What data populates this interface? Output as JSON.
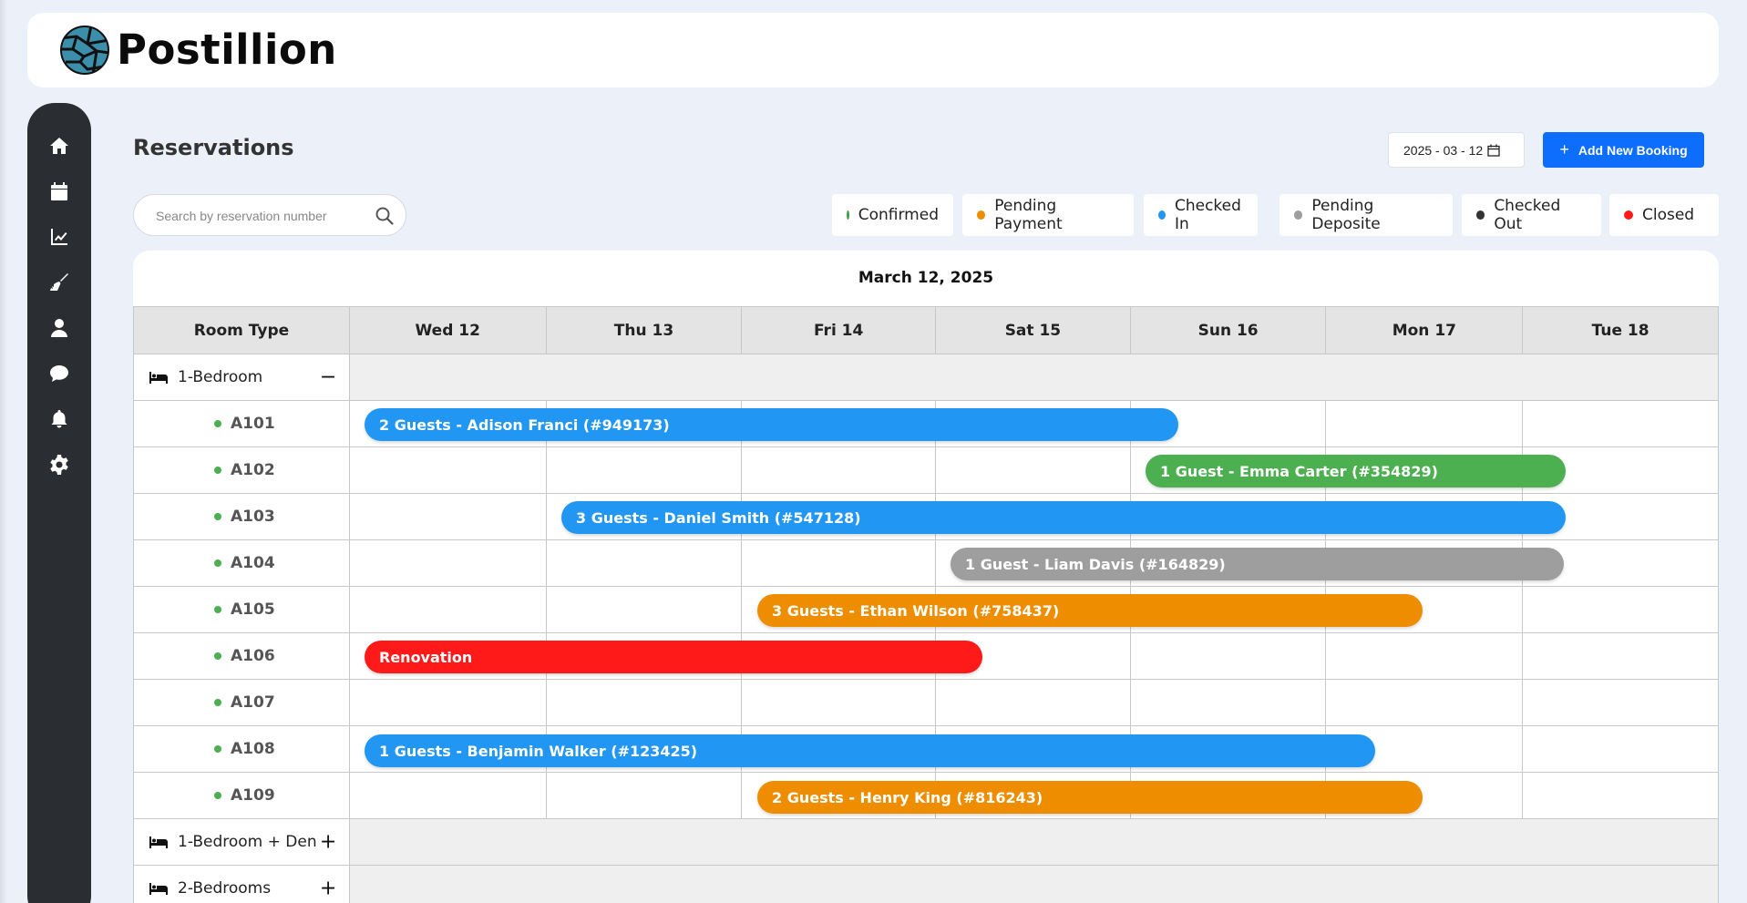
{
  "brand": {
    "name": "Postillion"
  },
  "sidebar": {
    "items": [
      {
        "icon": "home-icon"
      },
      {
        "icon": "calendar-icon"
      },
      {
        "icon": "chart-line-icon"
      },
      {
        "icon": "broom-icon"
      },
      {
        "icon": "user-icon"
      },
      {
        "icon": "chat-icon"
      },
      {
        "icon": "bell-icon"
      },
      {
        "icon": "gear-icon"
      }
    ]
  },
  "page": {
    "title": "Reservations",
    "date_value": "2025 - 03 - 12",
    "add_button": "Add New Booking",
    "search_placeholder": "Search by reservation number"
  },
  "legend": [
    {
      "label": "Confirmed",
      "color": "#43a047"
    },
    {
      "label": "Pending Payment",
      "color": "#ef8d00"
    },
    {
      "label": "Checked In",
      "color": "#2196f3"
    },
    {
      "label": "Pending Deposite",
      "color": "#9e9e9e"
    },
    {
      "label": "Checked Out",
      "color": "#333333"
    },
    {
      "label": "Closed",
      "color": "#ff1a1a"
    }
  ],
  "calendar": {
    "heading": "March 12, 2025",
    "room_type_header": "Room Type",
    "days": [
      "Wed 12",
      "Thu 13",
      "Fri 14",
      "Sat 15",
      "Sun 16",
      "Mon 17",
      "Tue 18"
    ],
    "groups": [
      {
        "label": "1-Bedroom",
        "toggle": "−"
      },
      {
        "label": "1-Bedroom + Den",
        "toggle": "+"
      },
      {
        "label": "2-Bedrooms",
        "toggle": "+"
      }
    ],
    "rooms": [
      "A101",
      "A102",
      "A103",
      "A104",
      "A105",
      "A106",
      "A107",
      "A108",
      "A109"
    ],
    "bookings": [
      {
        "label": "2 Guests - Adison Franci (#949173)",
        "color": "#2196f3"
      },
      {
        "label": "1 Guest - Emma Carter (#354829)",
        "color": "#4caf50"
      },
      {
        "label": "3 Guests - Daniel Smith (#547128)",
        "color": "#2196f3"
      },
      {
        "label": "1 Guest - Liam Davis (#164829)",
        "color": "#9e9e9e"
      },
      {
        "label": "3 Guests - Ethan Wilson (#758437)",
        "color": "#ef8d00"
      },
      {
        "label": "Renovation",
        "color": "#ff1a1a"
      },
      {
        "label": "1 Guests - Benjamin Walker (#123425)",
        "color": "#2196f3"
      },
      {
        "label": "2 Guests - Henry King (#816243)",
        "color": "#ef8d00"
      }
    ]
  }
}
